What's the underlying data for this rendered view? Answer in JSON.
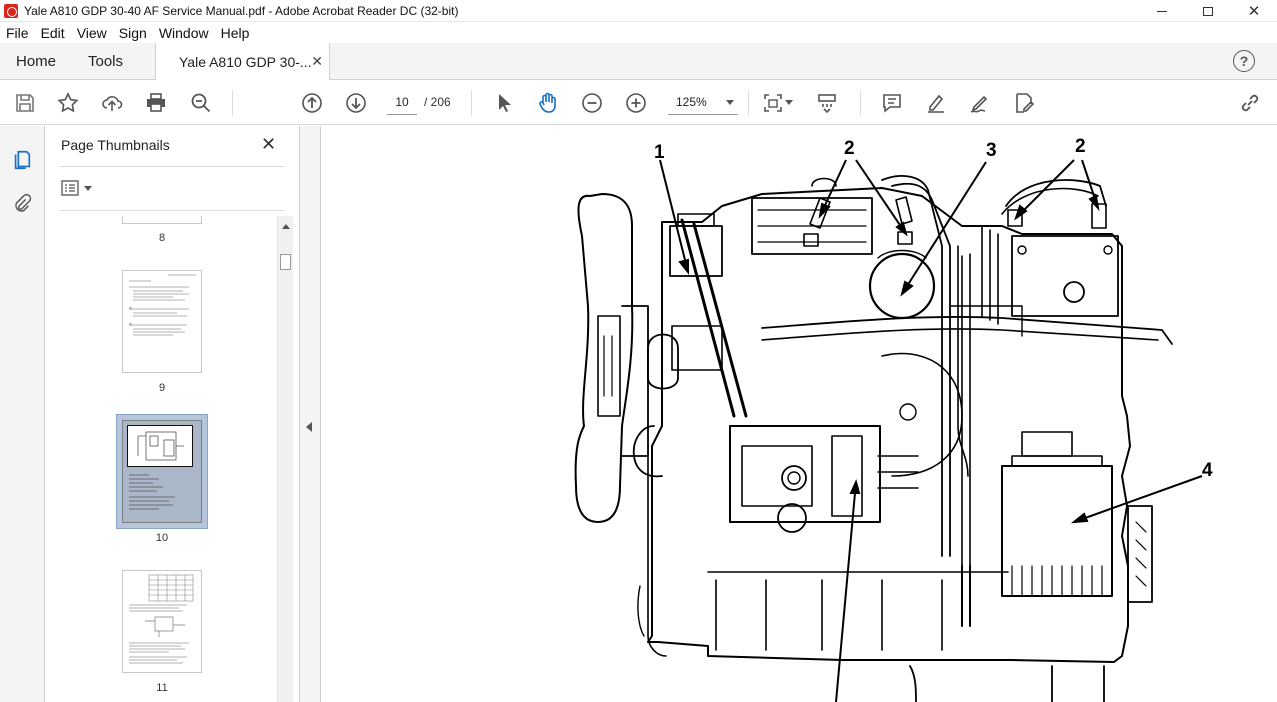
{
  "window": {
    "title": "Yale A810 GDP 30-40 AF Service Manual.pdf - Adobe Acrobat Reader DC (32-bit)"
  },
  "menu": [
    "File",
    "Edit",
    "View",
    "Sign",
    "Window",
    "Help"
  ],
  "tabs": {
    "home": "Home",
    "tools": "Tools",
    "document": "Yale A810 GDP 30-..."
  },
  "toolbar": {
    "current_page": "10",
    "total_pages": "/ 206",
    "zoom": "125%",
    "icons": [
      "save-icon",
      "bookmark-star-icon",
      "upload-icon",
      "print-icon",
      "zoom-search-icon",
      "prev-page-icon",
      "next-page-icon",
      "select-arrow-icon",
      "hand-tool-icon",
      "zoom-out-icon",
      "zoom-in-icon",
      "fit-page-icon",
      "scroll-mode-icon",
      "comment-icon",
      "highlight-icon",
      "sign-icon",
      "edit-pdf-icon",
      "share-link-icon"
    ]
  },
  "sidebar": {
    "title": "Page Thumbnails",
    "thumbnails": [
      {
        "label": "8"
      },
      {
        "label": "9"
      },
      {
        "label": "10",
        "selected": true
      },
      {
        "label": "11"
      }
    ]
  },
  "diagram": {
    "callouts": [
      "1",
      "2",
      "3",
      "2",
      "4"
    ],
    "colors": {
      "line": "#000000",
      "paper": "#ffffff"
    }
  }
}
